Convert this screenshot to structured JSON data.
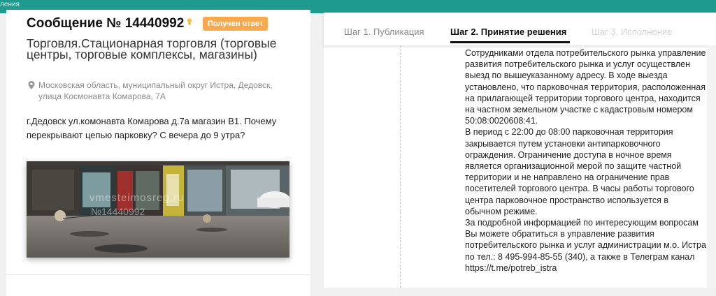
{
  "topbar": {
    "crumb": "ления"
  },
  "message": {
    "title": "Сообщение № 14440992",
    "status_badge": "Получен ответ",
    "category": "Торговля.Стационарная торговля (торговые центры, торговые комплексы, магазины)",
    "address": "Московская область, муниципальный округ Истра, Дедовск, улица Космонавта Комарова, 7А",
    "text": "г.Дедовск ул.комонавта Комарова д.7а магазин В1. Почему перекрывают цепью парковку? С вечера до 9 утра?",
    "photo_watermark_site": "vmesteimosreg.ru",
    "photo_watermark_id": "№14440992"
  },
  "tabs": [
    {
      "label": "Шаг 1. Публикация"
    },
    {
      "label": "Шаг 2. Принятие решения"
    },
    {
      "label": "Шаг 3. Исполнение"
    }
  ],
  "answer_text": "Сотрудниками отдела потребительского рынка управление развития потребительского рынка и услуг осуществлен выезд по вышеуказанному адресу. В ходе выезда установлено, что парковочная территория, расположенная на прилагающей территории торгового центра, находится на частном земельном участке с кадастровым номером 50:08:0020608:41.\nВ период с 22:00 до 08:00 парковочная территория закрывается путем установки антипарковочного ограждения. Ограничение доступа в ночное время является организационной мерой по защите частной территории и не направлено на ограничение прав посетителей торгового центра. В часы работы торгового центра парковочное пространство используется в обычном режиме.\nЗа подробной информацией по интересующим вопросам Вы можете обратиться в управление развития потребительского рынка и услуг администрации м.о. Истра по тел.: 8 495-994-85-55 (340), а также в Телеграм канал https://t.me/potreb_istra",
  "colors": {
    "topbar": "#1f9a8e",
    "badge": "#f7a94f"
  }
}
